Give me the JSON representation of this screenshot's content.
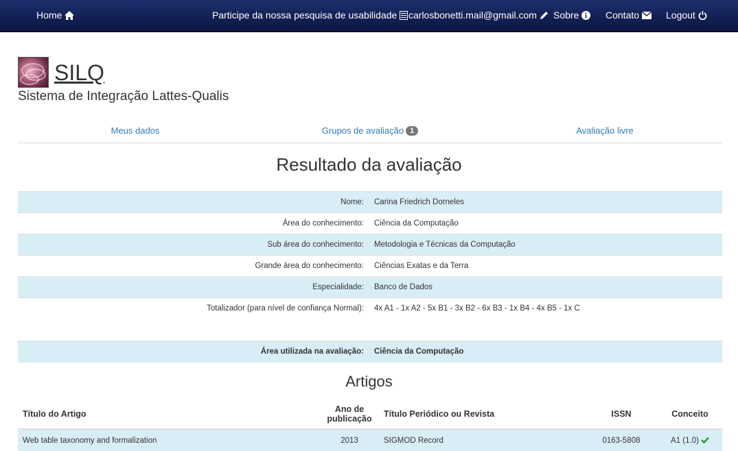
{
  "navbar": {
    "home": "Home",
    "survey": "Participe da nossa pesquisa de usabilidade",
    "user_email": "carlosbonetti.mail@gmail.com",
    "about": "Sobre",
    "contact": "Contato",
    "logout": "Logout"
  },
  "header": {
    "app_name": "SILQ",
    "subtitle": "Sistema de Integração Lattes-Qualis"
  },
  "tabs": [
    {
      "label": "Meus dados"
    },
    {
      "label": "Grupos de avaliação",
      "badge": "1"
    },
    {
      "label": "Avaliação livre"
    }
  ],
  "page_title": "Resultado da avaliação",
  "info": [
    {
      "label": "Nome:",
      "value": "Carina Friedrich Dorneles"
    },
    {
      "label": "Área do conhecimento:",
      "value": "Ciência da Computação"
    },
    {
      "label": "Sub área do conhecimento:",
      "value": "Metodologia e Técnicas da Computação"
    },
    {
      "label": "Grande área do conhecimento:",
      "value": "Ciências Exatas e da Terra"
    },
    {
      "label": "Especialidade:",
      "value": "Banco de Dados"
    },
    {
      "label": "Totalizador (para nível de confiança Normal):",
      "value": "4x A1 - 1x A2 - 5x B1 - 3x B2 - 6x B3 - 1x B4 - 4x B5 - 1x C"
    }
  ],
  "area_used": {
    "label": "Área utilizada na avaliação:",
    "value": "Ciência da Computação"
  },
  "articles": {
    "section_title": "Artigos",
    "headers": {
      "title": "Título do Artigo",
      "year_line1": "Ano de",
      "year_line2": "publicação",
      "journal": "Título Periódico ou Revista",
      "issn": "ISSN",
      "concept": "Conceito"
    },
    "rows": [
      {
        "title": "Web table taxonomy and formalization",
        "year": "2013",
        "journal": "SIGMOD Record",
        "issn": "0163-5808",
        "concept": "A1 (1.0)"
      }
    ]
  },
  "colors": {
    "navbar": "#0b153f",
    "link": "#337ab7",
    "row_highlight": "#d9edf7",
    "badge": "#777777",
    "check": "#2ca02c"
  },
  "icons": {
    "home": "home-icon",
    "survey": "list-alt-icon",
    "edit": "pencil-icon",
    "about": "info-sign-icon",
    "contact": "envelope-icon",
    "logout": "power-icon",
    "check": "check-icon"
  }
}
